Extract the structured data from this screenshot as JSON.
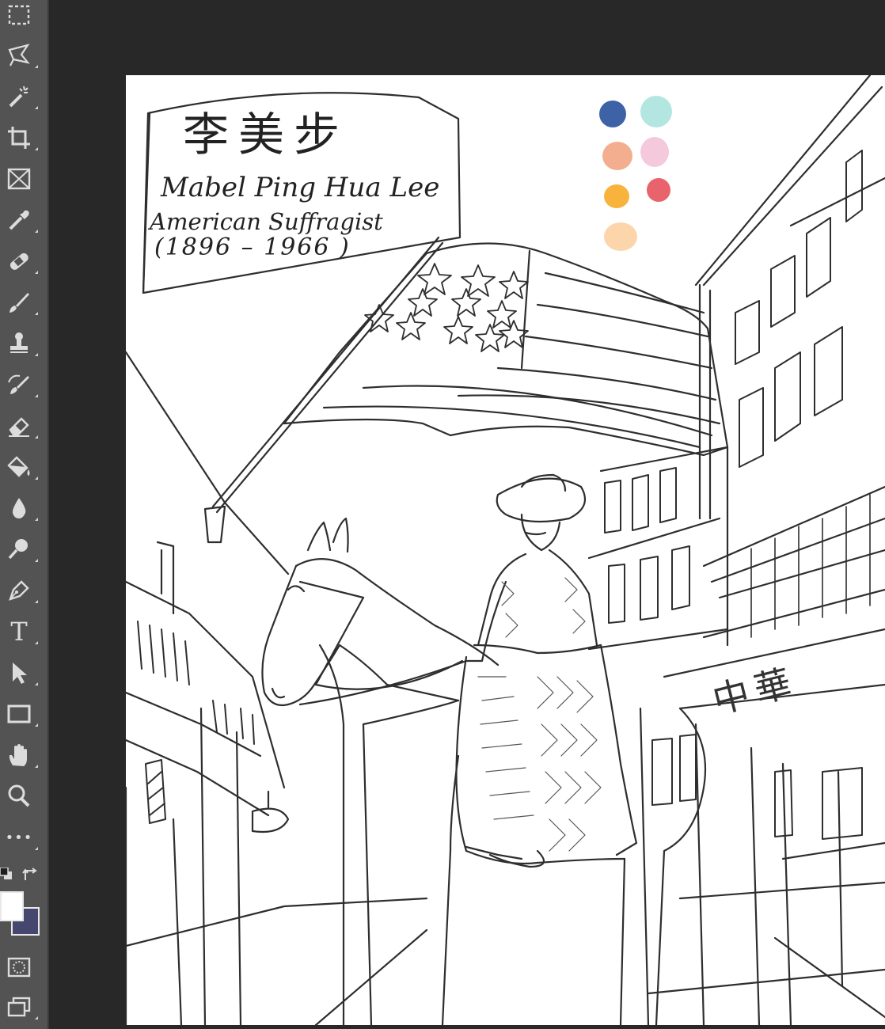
{
  "toolbar": {
    "tools": [
      {
        "name": "rectangular-marquee-tool",
        "icon": "marquee-icon"
      },
      {
        "name": "polygonal-lasso-tool",
        "icon": "lasso-icon"
      },
      {
        "name": "magic-wand-tool",
        "icon": "magic-wand-icon"
      },
      {
        "name": "crop-tool",
        "icon": "crop-icon"
      },
      {
        "name": "frame-tool",
        "icon": "frame-icon"
      },
      {
        "name": "eyedropper-tool",
        "icon": "eyedropper-icon"
      },
      {
        "name": "spot-healing-tool",
        "icon": "bandage-icon"
      },
      {
        "name": "brush-tool",
        "icon": "brush-icon"
      },
      {
        "name": "clone-stamp-tool",
        "icon": "stamp-icon"
      },
      {
        "name": "history-brush-tool",
        "icon": "history-brush-icon"
      },
      {
        "name": "eraser-tool",
        "icon": "eraser-icon"
      },
      {
        "name": "paint-bucket-tool",
        "icon": "paint-bucket-icon"
      },
      {
        "name": "blur-tool",
        "icon": "drop-icon"
      },
      {
        "name": "dodge-tool",
        "icon": "dodge-icon"
      },
      {
        "name": "pen-tool",
        "icon": "pen-icon"
      },
      {
        "name": "type-tool",
        "icon": "type-icon",
        "label": "T"
      },
      {
        "name": "path-selection-tool",
        "icon": "arrow-icon"
      },
      {
        "name": "rectangle-tool",
        "icon": "rectangle-icon"
      },
      {
        "name": "hand-tool",
        "icon": "hand-icon"
      },
      {
        "name": "zoom-tool",
        "icon": "zoom-icon"
      },
      {
        "name": "edit-toolbar",
        "icon": "ellipsis-icon",
        "label": "•••"
      }
    ],
    "foreground_color": "#45476f",
    "background_color": "#ffffff"
  },
  "canvas": {
    "caption": {
      "chinese": "李美步",
      "name": "Mabel Ping Hua Lee",
      "role": "American   Suffragist",
      "years": "(1896  – 1966 )"
    },
    "sign_chinese": "中華",
    "palette": [
      "#3d63a6",
      "#b4e6e1",
      "#f2ae8e",
      "#f5c9dc",
      "#f7b33c",
      "#e8636b",
      "#fcd5ab"
    ]
  }
}
